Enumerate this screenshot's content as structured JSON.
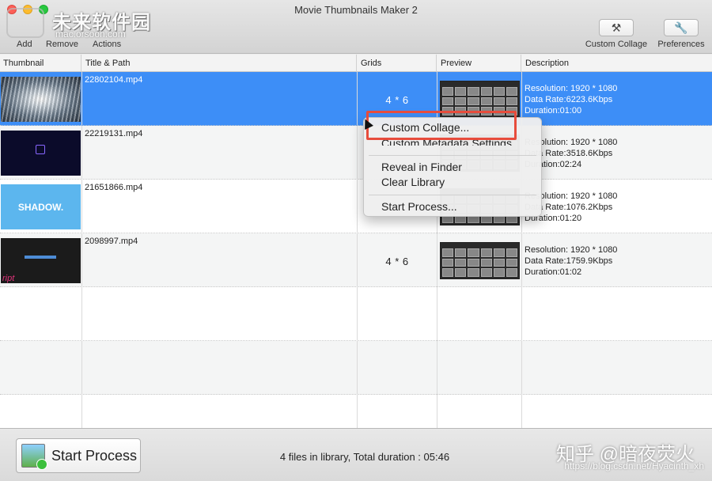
{
  "window": {
    "title": "Movie Thumbnails Maker 2"
  },
  "toolbar": {
    "add_label": "Add",
    "remove_label": "Remove",
    "actions_label": "Actions",
    "custom_collage_label": "Custom Collage",
    "preferences_label": "Preferences"
  },
  "watermark": {
    "cn": "未来软件园",
    "url": "mac.orsoon.com"
  },
  "table": {
    "columns": [
      "Thumbnail",
      "Title & Path",
      "Grids",
      "Preview",
      "Description"
    ],
    "rows": [
      {
        "title": "22802104.mp4",
        "grids": "4 * 6",
        "resolution": "Resolution: 1920 * 1080",
        "data_rate": "Data Rate:6223.6Kbps",
        "duration": "Duration:01:00"
      },
      {
        "title": "22219131.mp4",
        "grids": "",
        "resolution": "Resolution: 1920 * 1080",
        "data_rate": "Data Rate:3518.6Kbps",
        "duration": "Duration:02:24"
      },
      {
        "title": "21651866.mp4",
        "grids": "",
        "resolution": "Resolution: 1920 * 1080",
        "data_rate": "Data Rate:1076.2Kbps",
        "duration": "Duration:01:20"
      },
      {
        "title": "2098997.mp4",
        "grids": "4 * 6",
        "resolution": "Resolution: 1920 * 1080",
        "data_rate": "Data Rate:1759.9Kbps",
        "duration": "Duration:01:02"
      }
    ],
    "thumb3_text": "SHADOW.",
    "thumb4_text": "ript"
  },
  "context_menu": {
    "items": [
      "Custom Collage...",
      "Custom Metadata Settings...",
      "Reveal in Finder",
      "Clear Library",
      "Start Process..."
    ]
  },
  "bottom": {
    "start_label": "Start Process",
    "status": "4 files in library, Total duration : 05:46",
    "wm_cn": "知乎 @暗夜荧火",
    "wm_url": "https://blog.csdn.net/Hyacinth_xh"
  },
  "colors": {
    "selection": "#3d8ef7",
    "highlight_box": "#e74c3c"
  }
}
